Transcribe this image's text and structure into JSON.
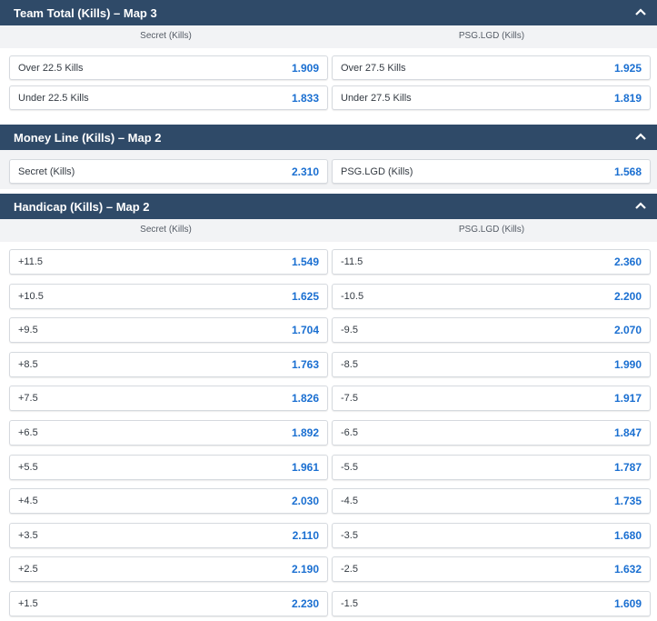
{
  "sections": [
    {
      "title": "Team Total (Kills) – Map 3",
      "col_left": "Secret (Kills)",
      "col_right": "PSG.LGD (Kills)",
      "rows": [
        {
          "left_label": "Over 22.5 Kills",
          "left_odd": "1.909",
          "right_label": "Over 27.5 Kills",
          "right_odd": "1.925"
        },
        {
          "left_label": "Under 22.5 Kills",
          "left_odd": "1.833",
          "right_label": "Under 27.5 Kills",
          "right_odd": "1.819"
        }
      ]
    },
    {
      "title": "Money Line (Kills) – Map 2",
      "rows": [
        {
          "left_label": "Secret (Kills)",
          "left_odd": "2.310",
          "right_label": "PSG.LGD (Kills)",
          "right_odd": "1.568"
        }
      ]
    },
    {
      "title": "Handicap (Kills) – Map 2",
      "col_left": "Secret (Kills)",
      "col_right": "PSG.LGD (Kills)",
      "rows": [
        {
          "left_label": "+11.5",
          "left_odd": "1.549",
          "right_label": "-11.5",
          "right_odd": "2.360"
        },
        {
          "left_label": "+10.5",
          "left_odd": "1.625",
          "right_label": "-10.5",
          "right_odd": "2.200"
        },
        {
          "left_label": "+9.5",
          "left_odd": "1.704",
          "right_label": "-9.5",
          "right_odd": "2.070"
        },
        {
          "left_label": "+8.5",
          "left_odd": "1.763",
          "right_label": "-8.5",
          "right_odd": "1.990"
        },
        {
          "left_label": "+7.5",
          "left_odd": "1.826",
          "right_label": "-7.5",
          "right_odd": "1.917"
        },
        {
          "left_label": "+6.5",
          "left_odd": "1.892",
          "right_label": "-6.5",
          "right_odd": "1.847"
        },
        {
          "left_label": "+5.5",
          "left_odd": "1.961",
          "right_label": "-5.5",
          "right_odd": "1.787"
        },
        {
          "left_label": "+4.5",
          "left_odd": "2.030",
          "right_label": "-4.5",
          "right_odd": "1.735"
        },
        {
          "left_label": "+3.5",
          "left_odd": "2.110",
          "right_label": "-3.5",
          "right_odd": "1.680"
        },
        {
          "left_label": "+2.5",
          "left_odd": "2.190",
          "right_label": "-2.5",
          "right_odd": "1.632"
        },
        {
          "left_label": "+1.5",
          "left_odd": "2.230",
          "right_label": "-1.5",
          "right_odd": "1.609"
        }
      ]
    }
  ],
  "icons": {
    "collapse": "chevron-up-icon"
  },
  "colors": {
    "header_bg": "#2f4a68",
    "odds": "#1a6fd1",
    "subheader_bg": "#f2f3f5"
  }
}
